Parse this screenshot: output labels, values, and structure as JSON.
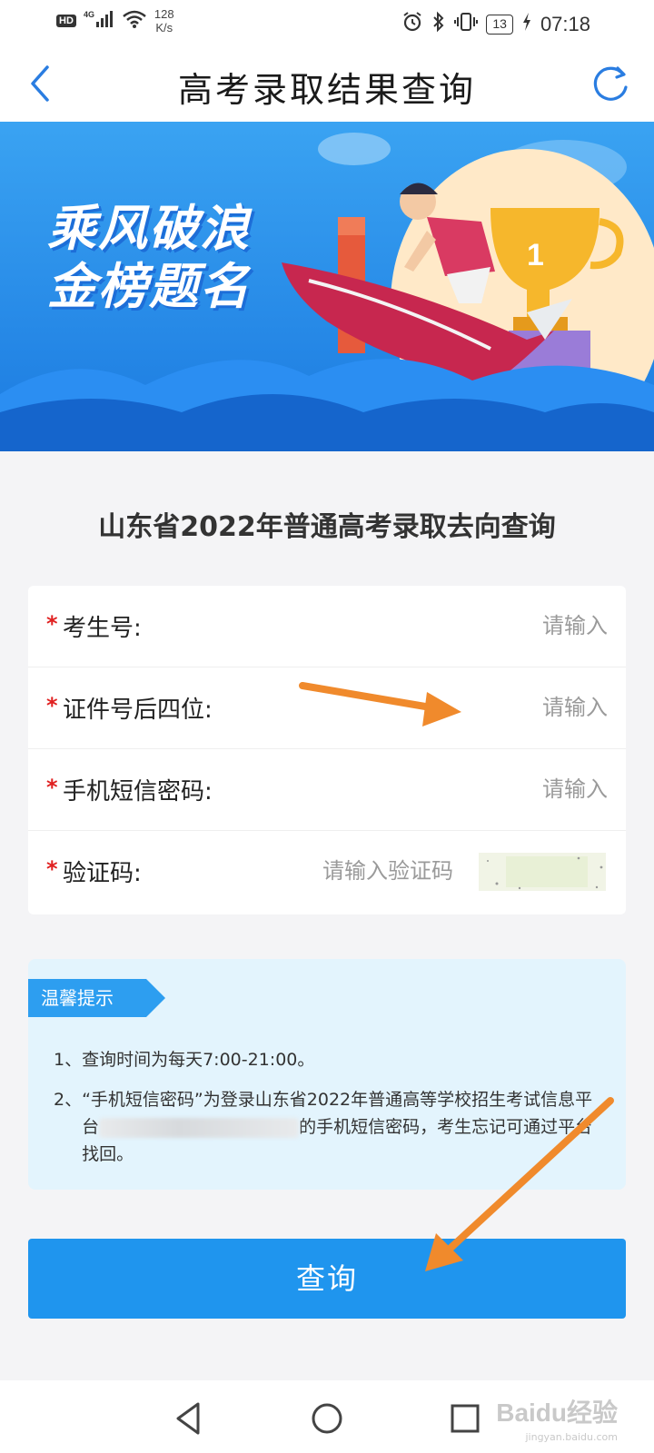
{
  "status_bar": {
    "hd": "HD",
    "network": "4G",
    "speed_value": "128",
    "speed_unit": "K/s",
    "battery": "13",
    "time": "07:18"
  },
  "header": {
    "title": "高考录取结果查询",
    "back_icon": "chevron-left-icon",
    "refresh_icon": "refresh-icon"
  },
  "banner": {
    "line1": "乘风破浪",
    "line2": "金榜题名",
    "trophy_number": "1"
  },
  "section_title": "山东省2022年普通高考录取去向查询",
  "form": {
    "fields": [
      {
        "label": "考生号:",
        "placeholder": "请输入",
        "required": "*"
      },
      {
        "label": "证件号后四位:",
        "placeholder": "请输入",
        "required": "*"
      },
      {
        "label": "手机短信密码:",
        "placeholder": "请输入",
        "required": "*"
      },
      {
        "label": "验证码:",
        "placeholder": "请输入验证码",
        "required": "*"
      }
    ]
  },
  "tips": {
    "badge": "温馨提示",
    "items": [
      {
        "num": "1、",
        "text": "查询时间为每天7:00-21:00。"
      },
      {
        "num": "2、",
        "text_before": "“手机短信密码”为登录山东省2022年普通高等学校招生考试信息平台",
        "text_after": "的手机短信密码，考生忘记可通过平台找回。"
      }
    ]
  },
  "query_button": "查询",
  "nav": {
    "back": "nav-back-icon",
    "home": "nav-home-icon",
    "recent": "nav-recent-icon"
  },
  "watermark": {
    "brand": "Baidu经验",
    "url": "jingyan.baidu.com"
  },
  "colors": {
    "accent": "#1f95ee",
    "required": "#e02020",
    "tips_bg": "#e3f4fd",
    "annotation_arrow": "#f08a2c"
  }
}
